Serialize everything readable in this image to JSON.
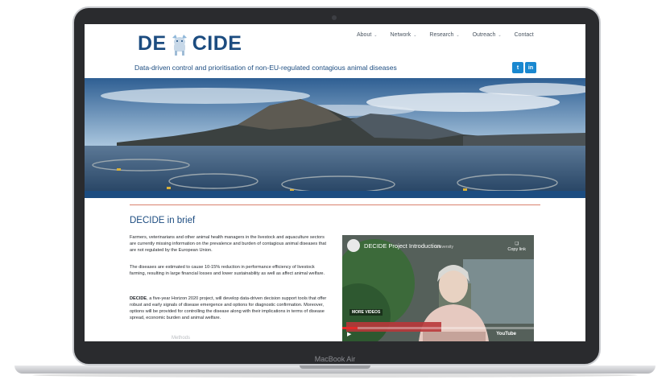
{
  "device": {
    "label": "MacBook Air"
  },
  "site": {
    "logo_left": "DE",
    "logo_right": "CIDE",
    "tagline": "Data-driven control and prioritisation of non-EU-regulated contagious animal diseases",
    "nav": [
      {
        "label": "About",
        "dropdown": true
      },
      {
        "label": "Network",
        "dropdown": true
      },
      {
        "label": "Research",
        "dropdown": true
      },
      {
        "label": "Outreach",
        "dropdown": true
      },
      {
        "label": "Contact",
        "dropdown": false
      }
    ],
    "social": {
      "twitter": "t",
      "linkedin": "in"
    },
    "accent": "#1c4c80",
    "divider_color": "#d9826e"
  },
  "brief": {
    "heading": "DECIDE in brief",
    "p1": "Farmers, veterinarians and other animal health managers in the livestock and aquaculture sectors are currently missing information on the prevalence and burden of contagious animal diseases that are not regulated by the European Union.",
    "p2": "The diseases are estimated to cause 10-15% reduction in performance efficiency of livestock farming, resulting in large financial losses and lower sustainability as well as affect animal welfare.",
    "p3_bold": "DECIDE",
    "p3": ", a five-year Horizon 2020 project, will develop data-driven decision support tools that offer robust and early signals of disease emergence and options for diagnostic confirmation. Moreover, options will be provided for controlling the disease along with their implications in terms of disease spread, economic burden and animal welfare.",
    "faded": "Methods"
  },
  "video": {
    "title": "DECIDE Project Introduction",
    "channel": "University",
    "copy_label": "Copy link",
    "more_label": "MORE VIDEOS",
    "brand": "YouTube",
    "progress": 0.08
  }
}
